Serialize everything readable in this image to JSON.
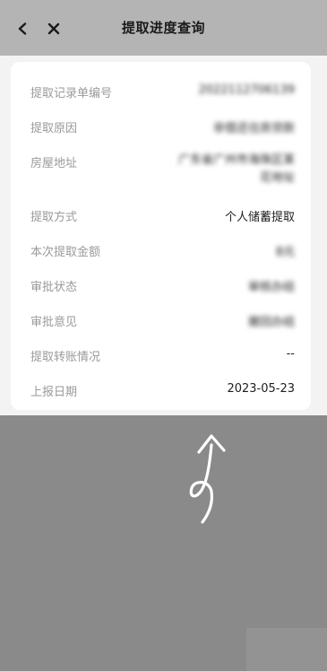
{
  "header": {
    "title": "提取进度查询"
  },
  "record": {
    "rows": [
      {
        "label": "提取记录单编号",
        "value": "2022112706139",
        "blurred": true
      },
      {
        "label": "提取原因",
        "value": "非偿还住房贷款",
        "blurred": true
      },
      {
        "label": "房屋地址",
        "value": "广东省广州市海珠区某\n花地址",
        "blurred": true
      },
      {
        "label": "提取方式",
        "value": "个人储蓄提取",
        "blurred": false
      },
      {
        "label": "本次提取金额",
        "value": "8元",
        "blurred": true
      },
      {
        "label": "审批状态",
        "value": "审核办结",
        "blurred": true
      },
      {
        "label": "审批意见",
        "value": "撤回办结",
        "blurred": true
      },
      {
        "label": "提取转账情况",
        "value": "--",
        "blurred": false
      },
      {
        "label": "上报日期",
        "value": "2023-05-23",
        "blurred": false
      }
    ]
  },
  "colors": {
    "topbar": "#b4b4b4",
    "overlay": "#8a8a8a",
    "label": "#9a9a9a",
    "value": "#1e1e1e"
  }
}
